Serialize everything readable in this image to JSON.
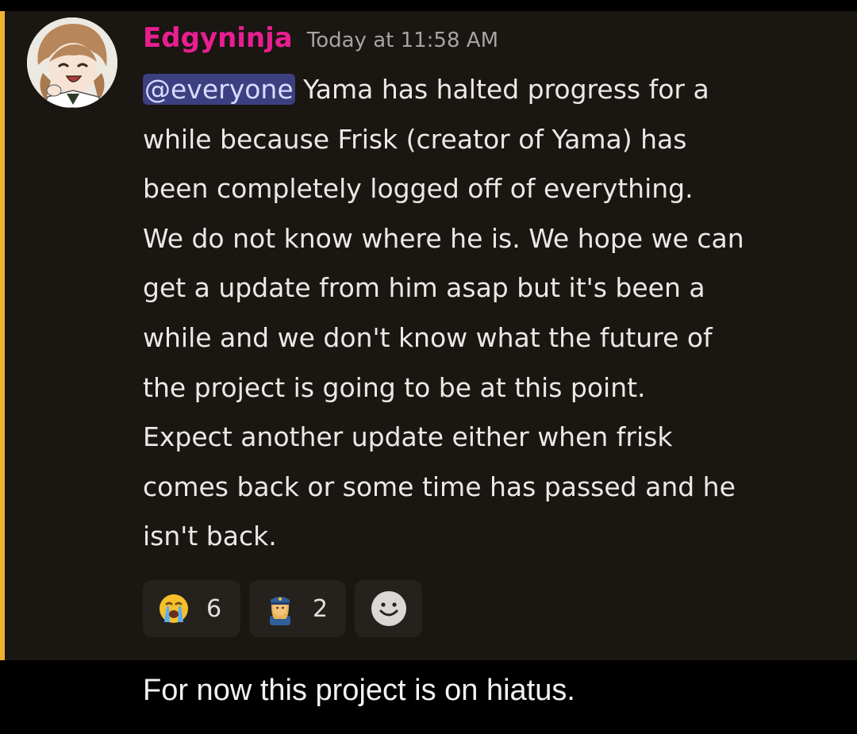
{
  "message": {
    "author": "Edgyninja",
    "timestamp": "Today at 11:58 AM",
    "mention": "@everyone",
    "lines": [
      " Yama has halted progress for a",
      "while because Frisk (creator of Yama) has",
      "been completely logged off of everything.",
      "We do not know where he is. We hope we can",
      "get a update from him asap but it's been a",
      "while and we don't know what the future of",
      "the project is going to be at this point.",
      "Expect another update either when frisk",
      "comes back or some time has passed and he",
      "isn't back."
    ],
    "author_color": "#e91e91",
    "mention_highlight": "#f0b132"
  },
  "reactions": [
    {
      "emoji": "loudly-crying-face-icon",
      "count": "6"
    },
    {
      "emoji": "woman-police-officer-icon",
      "count": "2"
    },
    {
      "emoji": "add-reaction-icon"
    }
  ],
  "caption": "For now this project is on hiatus."
}
